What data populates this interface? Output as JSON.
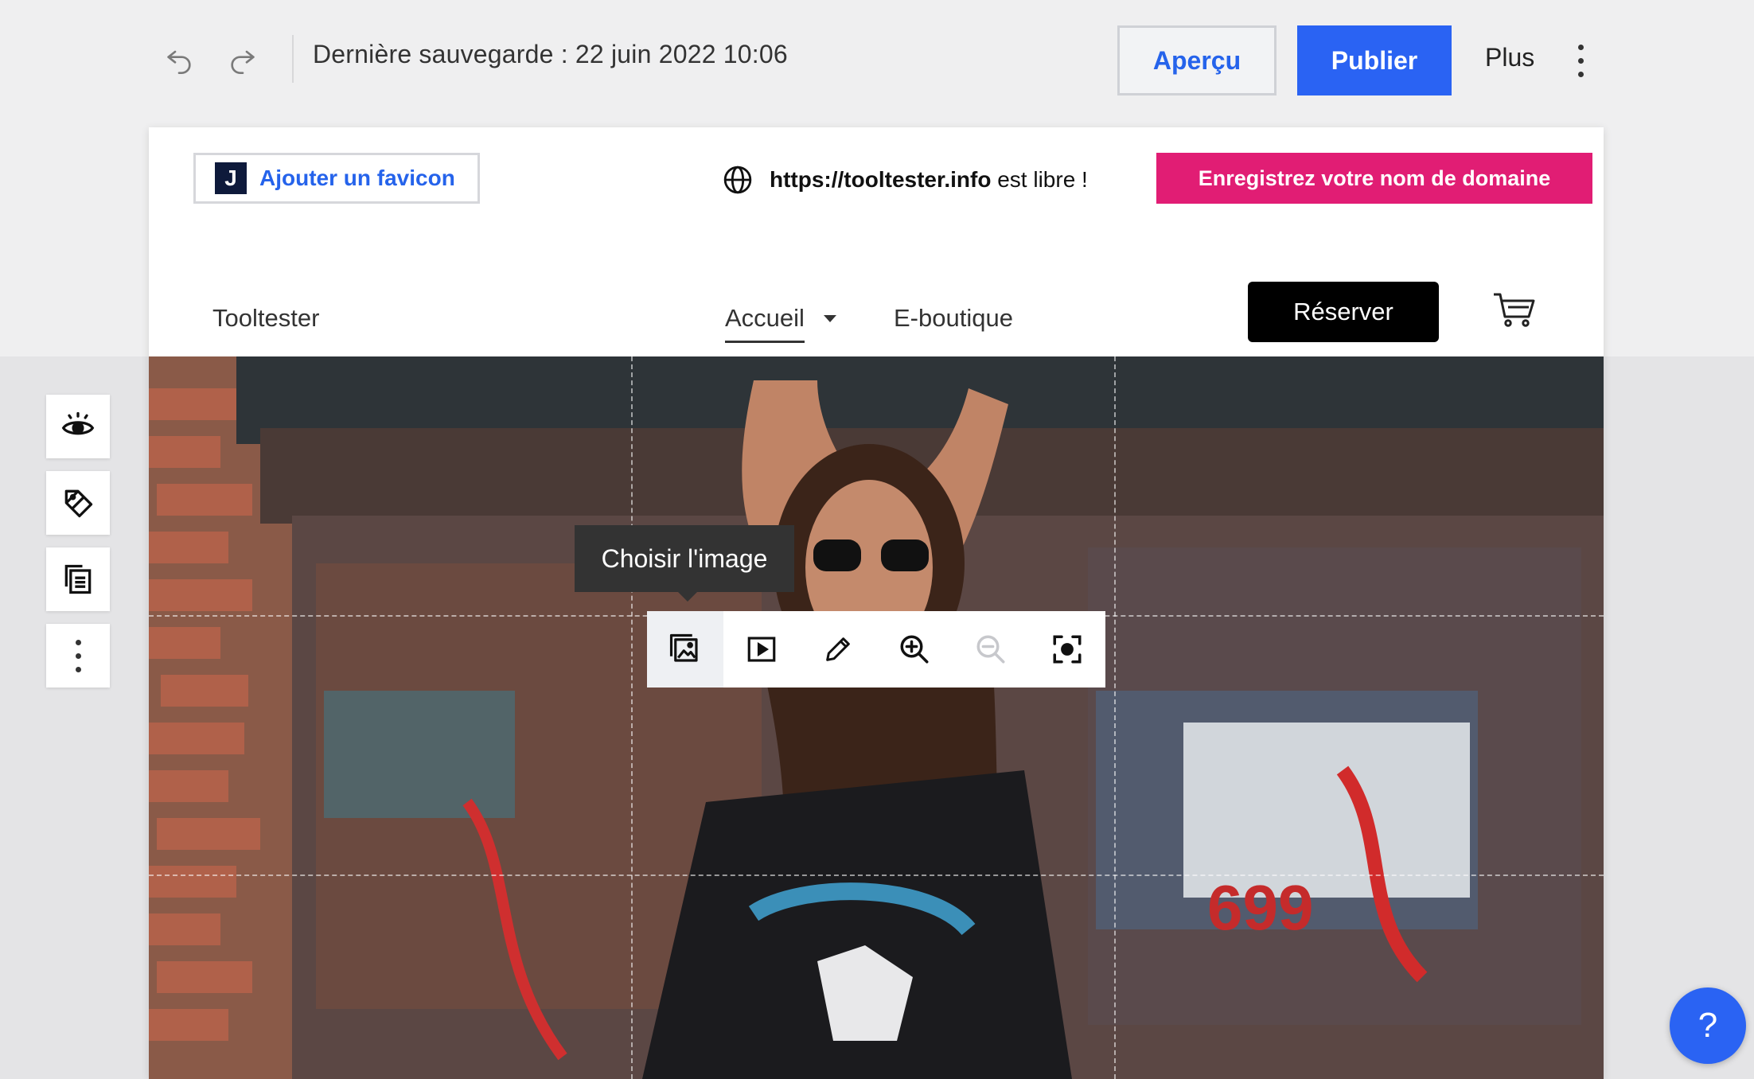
{
  "topbar": {
    "last_saved": "Dernière sauvegarde : 22 juin 2022 10:06",
    "preview_label": "Aperçu",
    "publish_label": "Publier",
    "more_label": "Plus"
  },
  "site": {
    "favicon_letter": "J",
    "favicon_label": "Ajouter un favicon",
    "domain_url": "https://tooltester.info",
    "domain_status": "est libre !",
    "register_label": "Enregistrez votre nom de domaine",
    "brand": "Tooltester",
    "nav": {
      "home": "Accueil",
      "shop": "E-boutique",
      "book_label": "Réserver"
    }
  },
  "image_editor": {
    "tooltip": "Choisir l'image"
  },
  "help_label": "?",
  "colors": {
    "primary_blue": "#2a63f3",
    "register_pink": "#e11d74",
    "book_black": "#000000"
  }
}
